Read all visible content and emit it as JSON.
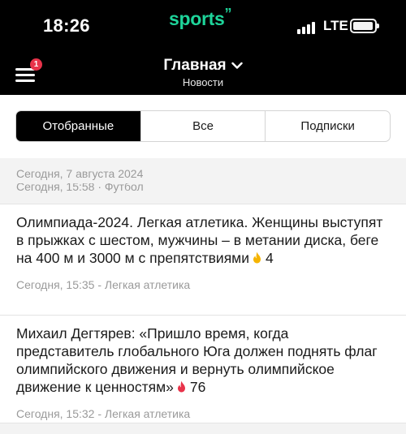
{
  "status_bar": {
    "time": "18:26",
    "network": "LTE",
    "icons": [
      "signal-icon",
      "battery-icon"
    ]
  },
  "brand": {
    "logo_text": "sports",
    "logo_accent": "”",
    "color": "#1ed49a"
  },
  "header": {
    "title": "Главная",
    "subtitle": "Новости",
    "menu_badge": "1",
    "icons": [
      "menu-icon",
      "chevron-down-icon"
    ]
  },
  "tabs": [
    {
      "label": "Отобранные",
      "active": true
    },
    {
      "label": "Все",
      "active": false
    },
    {
      "label": "Подписки",
      "active": false
    }
  ],
  "feed": {
    "date_heading": "Сегодня, 7 августа 2024",
    "partial_item_meta": "Сегодня, 15:58 · Футбол",
    "articles": [
      {
        "title": "Олимпиада-2024. Легкая атлетика. Женщины выступят в прыжках с шестом, мужчины – в метании диска, беге на 400 м и 3000 м с препятствиями",
        "count": "4",
        "fire_color": "#f5b400",
        "meta": "Сегодня, 15:35 - Легкая атлетика"
      },
      {
        "title": "Михаил Дегтярев: «Пришло время, когда представитель глобального Юга должен поднять флаг олимпийского движения и вернуть олимпийское движение к ценностям»",
        "count": "76",
        "fire_color": "#e8334a",
        "meta": "Сегодня, 15:32 - Легкая атлетика"
      }
    ]
  },
  "colors": {
    "topbar": "#000000",
    "accent_green": "#1ed49a",
    "badge_red": "#e8334a",
    "meta_gray": "#9a9a9a"
  }
}
